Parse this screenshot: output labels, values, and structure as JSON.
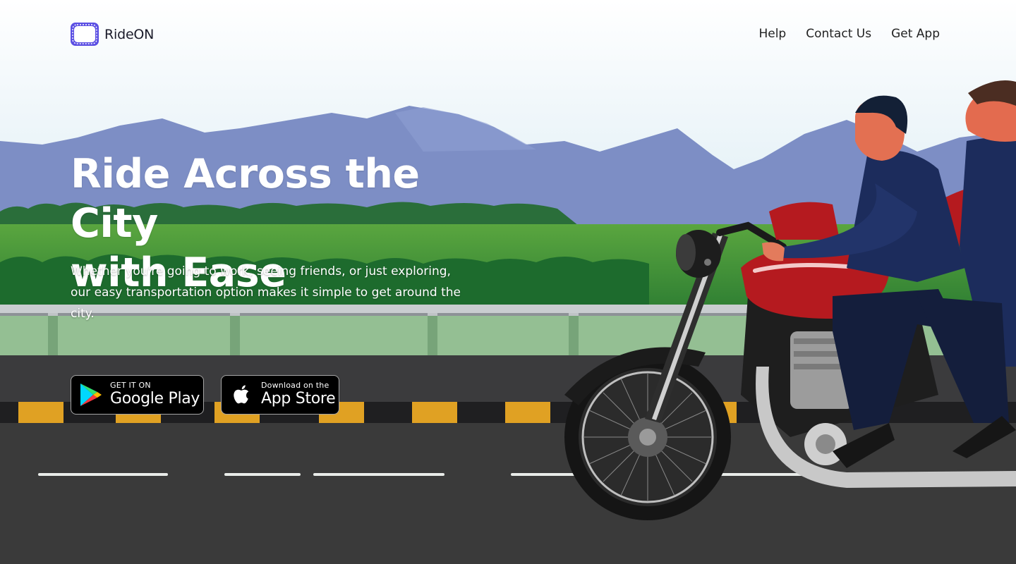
{
  "brand": {
    "name": "RideON",
    "logo_icon": "rideon-logo-icon",
    "accent_color": "#5b4fe3"
  },
  "nav": {
    "links": [
      "Help",
      "Contact Us",
      "Get App"
    ]
  },
  "hero": {
    "title_line1": "Ride Across the City",
    "title_line2": "with Ease",
    "subtitle": "Whether you're going to work, seeing friends, or just exploring, our easy transportation option makes it simple to get around the city."
  },
  "stores": {
    "google": {
      "small": "GET IT ON",
      "big": "Google Play",
      "icon": "google-play-icon"
    },
    "apple": {
      "small": "Download on the",
      "big": "App Store",
      "icon": "apple-icon"
    }
  },
  "scene": {
    "colors": {
      "sky": "#eaf3f8",
      "mountains": "#7e8fc4",
      "grass": "#3f8f3a",
      "trees": "#216b2a",
      "road": "#3a3a3a",
      "curb_yellow": "#e3a21f",
      "motorcycle_tank": "#b3161c",
      "rider_jacket": "#1c2c5c"
    }
  }
}
